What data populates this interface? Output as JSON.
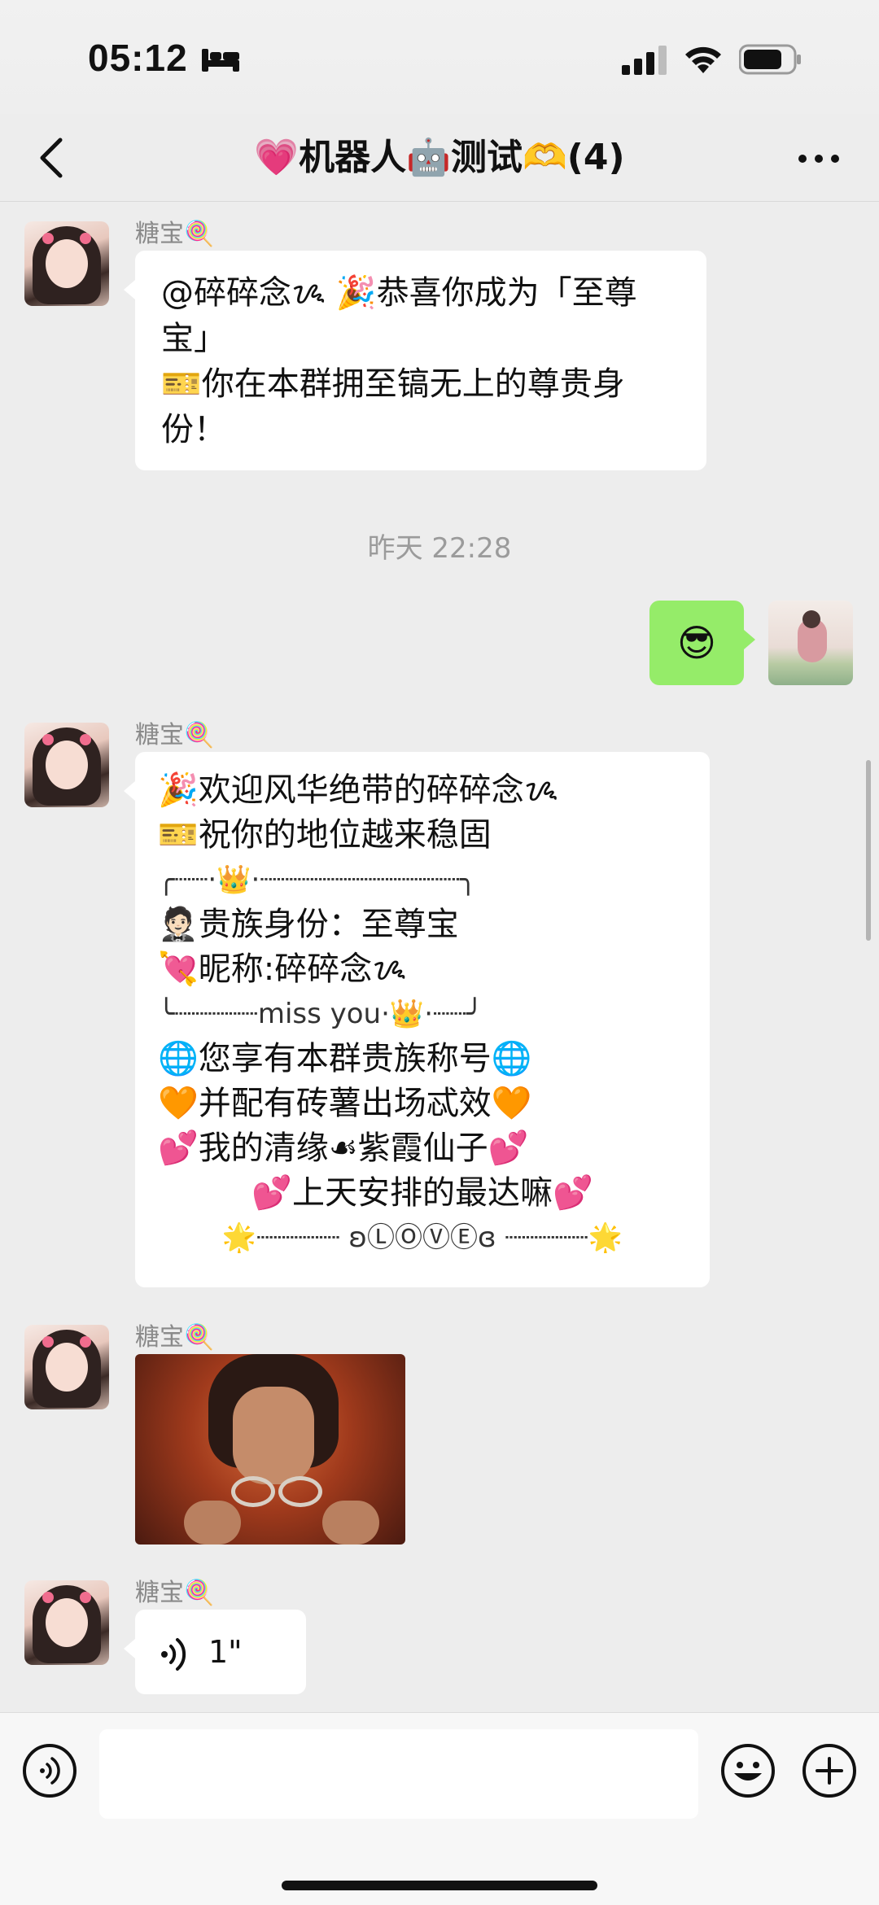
{
  "status_bar": {
    "time": "05:12",
    "icons": [
      "sleep-bed-icon",
      "cellular-signal-icon",
      "wifi-icon",
      "battery-icon"
    ]
  },
  "header": {
    "title": "💗机器人🤖测试🫶(4)",
    "back_icon": "chevron-left-icon",
    "more_icon": "more-dots-icon"
  },
  "messages": [
    {
      "sender": "糖宝🍭",
      "lines": [
        "@碎碎念ᝰ 🎉恭喜你成为「至尊",
        "宝」",
        "🎫你在本群拥至镐无上的尊贵身",
        "份！"
      ]
    },
    {
      "timestamp": "昨天 22:28"
    },
    {
      "self_emoji": "😎"
    },
    {
      "sender": "糖宝🍭",
      "lines": [
        "🎉欢迎风华绝带的碎碎念ᝰ",
        "🎫祝你的地位越来稳固",
        "╭┈┈·👑·┈┈┈┈┈┈┈┈┈┈┈┈╮",
        "🤵🏻贵族身份：至尊宝",
        "💘昵称:碎碎念ᝰ",
        "╰┈┈┈┈┈miss you·👑·┈┈╯",
        "🌐您享有本群贵族称号🌐",
        "🧡并配有砖薯出场忒效🧡",
        "💕我的清缘☙紫霞仙子💕",
        "💕上天安排的最达嘛💕",
        "🌟┈┈┈┈┈ ʚⓁⓄⓋⒺɞ ┈┈┈┈┈🌟"
      ]
    },
    {
      "sender": "糖宝🍭",
      "image": "movie-still-image"
    },
    {
      "sender": "糖宝🍭",
      "voice_duration": "1\""
    }
  ],
  "input_bar": {
    "voice_icon": "voice-input-icon",
    "emoji_icon": "emoji-icon",
    "plus_icon": "plus-circle-icon",
    "input_value": ""
  }
}
